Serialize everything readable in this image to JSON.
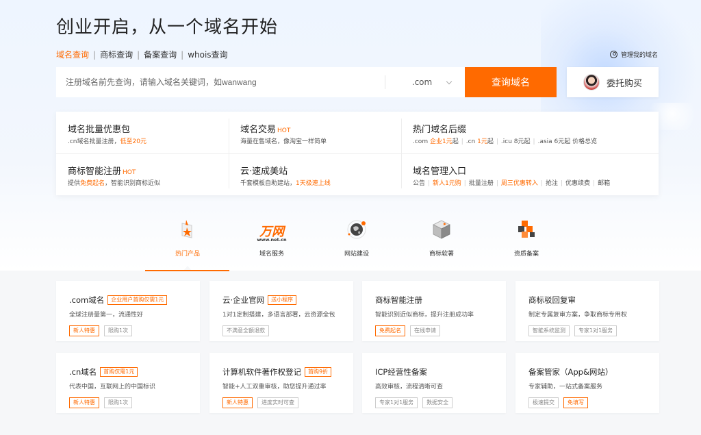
{
  "hero": {
    "title": "创业开启，从一个域名开始",
    "tabs": [
      "域名查询",
      "商标查询",
      "备案查询",
      "whois查询"
    ],
    "active_tab": 0,
    "manage_link": "管理我的域名"
  },
  "search": {
    "placeholder": "注册域名前先查询，请输入域名关键词，如wanwang",
    "value": "",
    "suffix": ".com",
    "button": "查询域名",
    "delegate": "委托购买"
  },
  "panel": {
    "cells": [
      {
        "title": "域名批量优惠包",
        "hot": "",
        "sub": [
          {
            "t": ".cn域名批量注册，",
            "o": false
          },
          {
            "t": "低至20元",
            "o": true
          }
        ]
      },
      {
        "title": "域名交易",
        "hot": "HOT",
        "sub": [
          {
            "t": "海量在售域名，像淘宝一样简单",
            "o": false
          }
        ]
      },
      {
        "title": "热门域名后缀",
        "hot": "",
        "sub": [
          {
            "t": ".com ",
            "o": false
          },
          {
            "t": "企业1元",
            "o": true
          },
          {
            "t": "起",
            "o": false
          },
          {
            "t": "|",
            "sep": true
          },
          {
            "t": ".cn ",
            "o": false
          },
          {
            "t": "1元",
            "o": true
          },
          {
            "t": "起",
            "o": false
          },
          {
            "t": "|",
            "sep": true
          },
          {
            "t": ".icu 8元起",
            "o": false
          },
          {
            "t": "|",
            "sep": true
          },
          {
            "t": ".asia 6元起  价格总览",
            "o": false
          }
        ]
      },
      {
        "title": "商标智能注册",
        "hot": "HOT",
        "sub": [
          {
            "t": "提供",
            "o": false
          },
          {
            "t": "免费起名",
            "o": true
          },
          {
            "t": "，智能识别商标近似",
            "o": false
          }
        ]
      },
      {
        "title": "云·速成美站",
        "hot": "",
        "sub": [
          {
            "t": "千套模板自助建站，",
            "o": false
          },
          {
            "t": "1天极速上线",
            "o": true
          }
        ]
      },
      {
        "title": "域名管理入口",
        "hot": "",
        "sub": [
          {
            "t": "公告",
            "o": false
          },
          {
            "t": "|",
            "sep": true
          },
          {
            "t": "新人1元购",
            "o": true
          },
          {
            "t": "|",
            "sep": true
          },
          {
            "t": "批量注册",
            "o": false
          },
          {
            "t": "|",
            "sep": true
          },
          {
            "t": "周三优惠转入",
            "o": true
          },
          {
            "t": "|",
            "sep": true
          },
          {
            "t": "抢注",
            "o": false
          },
          {
            "t": "|",
            "sep": true
          },
          {
            "t": "优惠续费",
            "o": false
          },
          {
            "t": "|",
            "sep": true
          },
          {
            "t": "邮箱",
            "o": false
          }
        ]
      }
    ]
  },
  "categories": {
    "items": [
      {
        "label": "热门产品",
        "icon": "hot-product-icon"
      },
      {
        "label": "域名服务",
        "icon": "wanwang-logo",
        "logo_text": "万网",
        "logo_sub": "www.net.cn"
      },
      {
        "label": "网站建设",
        "icon": "globe-icon"
      },
      {
        "label": "商标软著",
        "icon": "trademark-cube-icon"
      },
      {
        "label": "资质备案",
        "icon": "qualification-cubes-icon"
      }
    ],
    "active": 0
  },
  "cards": [
    {
      "title": ".com域名",
      "badge": "企业用户首购仅需1元",
      "desc": "全球注册量第一，流通性好",
      "tags": [
        {
          "t": "新人特惠",
          "o": true
        },
        {
          "t": "限购1次",
          "o": false
        }
      ]
    },
    {
      "title": "云·企业官网",
      "badge": "送小程序",
      "desc": "1对1定制搭建，多语言部署，云资源全包",
      "tags": [
        {
          "t": "不满意全额退款",
          "o": false
        }
      ]
    },
    {
      "title": "商标智能注册",
      "badge": "",
      "desc": "智能识别近似商标，提升注册成功率",
      "tags": [
        {
          "t": "免费起名",
          "o": true
        },
        {
          "t": "在线申请",
          "o": false
        }
      ]
    },
    {
      "title": "商标驳回复审",
      "badge": "",
      "desc": "制定专属复审方案，争取商标专用权",
      "tags": [
        {
          "t": "智能系统监测",
          "o": false
        },
        {
          "t": "专家1对1服务",
          "o": false
        }
      ]
    },
    {
      "title": ".cn域名",
      "badge": "首购仅需1元",
      "desc": "代表中国，互联网上的中国标识",
      "tags": [
        {
          "t": "新人特惠",
          "o": true
        },
        {
          "t": "限购1次",
          "o": false
        }
      ]
    },
    {
      "title": "计算机软件著作权登记",
      "badge": "首购9折",
      "desc": "智能+人工双重审核，助您提升通过率",
      "tags": [
        {
          "t": "新人特惠",
          "o": true
        },
        {
          "t": "进度实时可查",
          "o": false
        }
      ]
    },
    {
      "title": "ICP经营性备案",
      "badge": "",
      "desc": "高效审核，流程清晰可查",
      "tags": [
        {
          "t": "专家1对1服务",
          "o": false
        },
        {
          "t": "数据安全",
          "o": false
        }
      ]
    },
    {
      "title": "备案管家（App&网站）",
      "badge": "",
      "desc": "专家辅助，一站式备案服务",
      "tags": [
        {
          "t": "极速提交",
          "o": false
        },
        {
          "t": "免填写",
          "o": true
        }
      ]
    }
  ],
  "colors": {
    "accent": "#ff6a00",
    "text": "#333333",
    "bg": "#f6f7f9"
  }
}
